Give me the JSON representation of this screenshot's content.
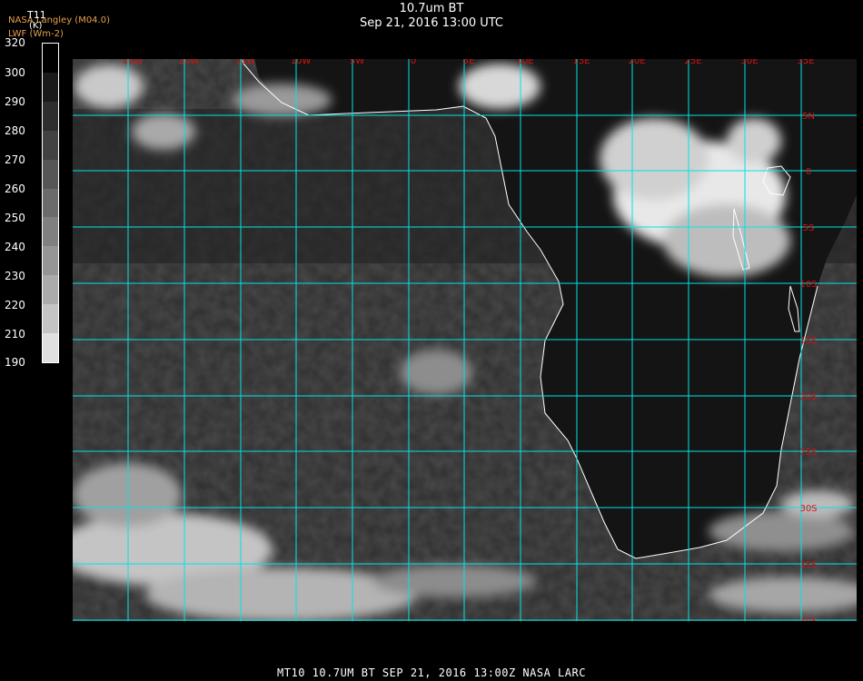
{
  "header": {
    "title": "10.7um BT",
    "subtitle": "Sep 21, 2016 13:00 UTC"
  },
  "credits": {
    "line1": "NASA Langley (M04.0)",
    "line2": "LWF (Wm-2)"
  },
  "colorbar": {
    "variable": "T11",
    "unit": "(K)",
    "ticks": [
      "320",
      "300",
      "290",
      "280",
      "270",
      "260",
      "250",
      "240",
      "230",
      "220",
      "210",
      "190"
    ],
    "levels": [
      "#000000",
      "#1a1a1a",
      "#2e2e2e",
      "#424242",
      "#565656",
      "#6b6b6b",
      "#808080",
      "#959595",
      "#ababab",
      "#c4c4c4",
      "#e0e0e0"
    ]
  },
  "map": {
    "lon_labels": [
      "25W",
      "20W",
      "15W",
      "10W",
      "5W",
      "0",
      "5E",
      "10E",
      "15E",
      "20E",
      "25E",
      "30E",
      "35E"
    ],
    "lat_labels": [
      "5N",
      "0",
      "5S",
      "10S",
      "15S",
      "20S",
      "25S",
      "30S",
      "35S",
      "40S"
    ],
    "grid_color": "#00e5e5",
    "label_color": "#e01010",
    "coast_color": "#ffffff"
  },
  "footer": {
    "text": "MT10   10.7UM BT    SEP 21, 2016 13:00Z   NASA LARC"
  }
}
